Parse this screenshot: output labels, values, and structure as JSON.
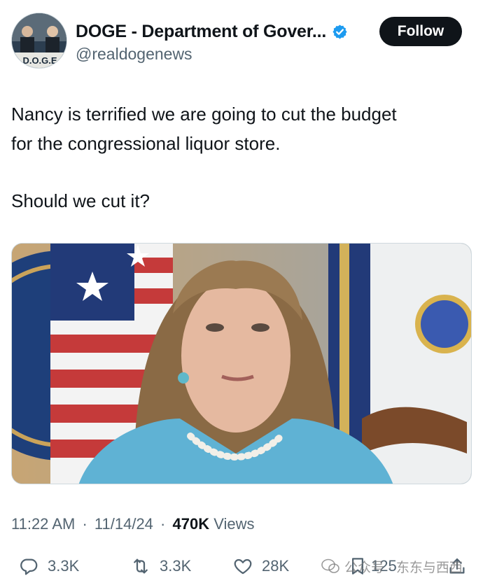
{
  "author": {
    "display_name": "DOGE - Department of Gover...",
    "handle": "@realdogenews",
    "avatar_label": "D.O.G.E",
    "verified": true
  },
  "follow_button": {
    "label": "Follow"
  },
  "tweet": {
    "line_1": "Nancy is terrified we are going to cut the budget",
    "line_2": "for the congressional liquor store.",
    "line_3": "Should we cut it?"
  },
  "media": {
    "description_hidden": ""
  },
  "meta": {
    "time": "11:22 AM",
    "separator": "·",
    "date": "11/14/24",
    "views_count": "470K",
    "views_label": "Views"
  },
  "actions": {
    "replies": "3.3K",
    "reposts": "3.3K",
    "likes": "28K",
    "bookmarks": "125"
  },
  "watermark": {
    "text": "公众号 · 东东与西西"
  },
  "colors": {
    "text_primary": "#0f1419",
    "text_secondary": "#536471",
    "verified_blue": "#1d9bf0",
    "follow_bg": "#0f1419"
  },
  "icons": {
    "verified": "verified-badge-icon",
    "reply": "reply-icon",
    "repost": "repost-icon",
    "like": "heart-icon",
    "bookmark": "bookmark-icon",
    "share": "share-icon"
  }
}
